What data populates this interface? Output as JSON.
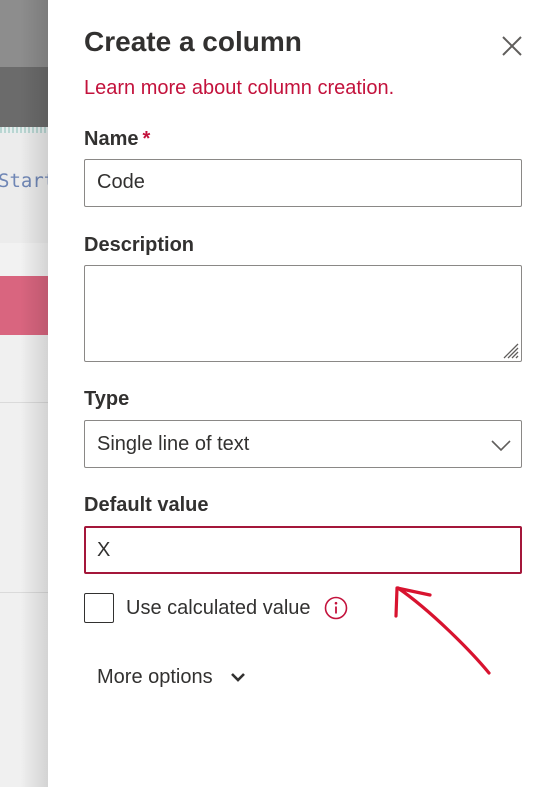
{
  "panel": {
    "title": "Create a column",
    "learn_more_link": "Learn more about column creation."
  },
  "background": {
    "code_snippet": "Start"
  },
  "fields": {
    "name": {
      "label": "Name",
      "required_marker": "*",
      "value": "Code"
    },
    "description": {
      "label": "Description",
      "value": ""
    },
    "type": {
      "label": "Type",
      "selected": "Single line of text"
    },
    "default_value": {
      "label": "Default value",
      "value": "X"
    },
    "use_calculated": {
      "label": "Use calculated value",
      "checked": false
    }
  },
  "more_options": {
    "label": "More options"
  },
  "colors": {
    "accent": "#c3123c",
    "highlight_border": "#a4173a",
    "annotation_arrow": "#d8132f"
  },
  "icons": {
    "close": "close-icon",
    "chevron": "chevron-down-icon",
    "info": "info-icon",
    "resize": "resize-grip-icon"
  }
}
